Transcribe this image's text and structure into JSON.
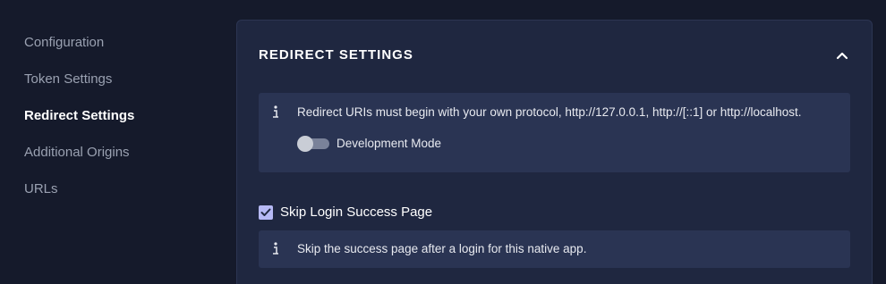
{
  "sidebar": {
    "items": [
      {
        "label": "Configuration",
        "active": false
      },
      {
        "label": "Token Settings",
        "active": false
      },
      {
        "label": "Redirect Settings",
        "active": true
      },
      {
        "label": "Additional Origins",
        "active": false
      },
      {
        "label": "URLs",
        "active": false
      }
    ]
  },
  "panel": {
    "title": "REDIRECT SETTINGS",
    "collapse_icon": "chevron-up-icon",
    "redirect_info": {
      "icon": "info-icon",
      "text": "Redirect URIs must begin with your own protocol, http://127.0.0.1, http://[::1] or http://localhost."
    },
    "development_mode": {
      "label": "Development Mode",
      "enabled": false
    },
    "skip_login": {
      "label": "Skip Login Success Page",
      "checked": true,
      "info_text": "Skip the success page after a login for this native app."
    }
  },
  "colors": {
    "background": "#151a2b",
    "panel": "#1f2740",
    "info_box": "#2a3453",
    "accent": "#b6b9f5"
  }
}
